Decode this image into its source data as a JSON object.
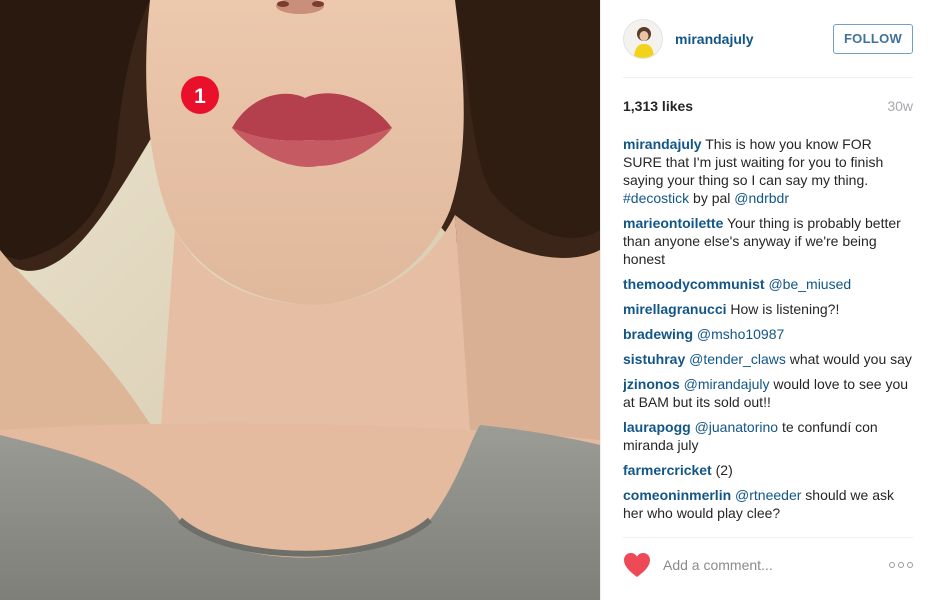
{
  "post": {
    "username": "mirandajuly",
    "follow_label": "FOLLOW",
    "likes": "1,313 likes",
    "age": "30w",
    "sticker_number": "1",
    "add_comment_placeholder": "Add a comment...",
    "caption": {
      "user": "mirandajuly",
      "text": " This is how you know FOR SURE that I'm just waiting for you to finish saying your thing so I can say my thing. ",
      "hashtag": "#decostick",
      "text2": " by pal ",
      "mention": "@ndrbdr"
    }
  },
  "comments": [
    {
      "user": "marieontoilette",
      "mention": "",
      "text": " Your thing is probably better than anyone else's anyway if we're being honest"
    },
    {
      "user": "themoodycommunist",
      "mention": "@be_miused",
      "text": ""
    },
    {
      "user": "mirellagranucci",
      "mention": "",
      "text": " How is listening?!"
    },
    {
      "user": "bradewing",
      "mention": "@msho10987",
      "text": ""
    },
    {
      "user": "sistuhray",
      "mention": "@tender_claws",
      "text": " what would you say"
    },
    {
      "user": "jzinonos",
      "mention": "@mirandajuly",
      "text": " would love to see you at BAM but its sold out!!"
    },
    {
      "user": "laurapogg",
      "mention": "@juanatorino",
      "text": " te confundí con miranda july"
    },
    {
      "user": "farmercricket",
      "mention": "",
      "text": " (2)"
    },
    {
      "user": "comeoninmerlin",
      "mention": "@rtneeder",
      "text": " should we ask her who would play clee?"
    }
  ],
  "colors": {
    "link_blue": "#125688",
    "follow_border": "#70a0c8",
    "heart_red": "#ed4956",
    "sticker_red": "#e8102b"
  },
  "icons": {
    "like": "heart-icon",
    "more": "more-options-icon"
  }
}
